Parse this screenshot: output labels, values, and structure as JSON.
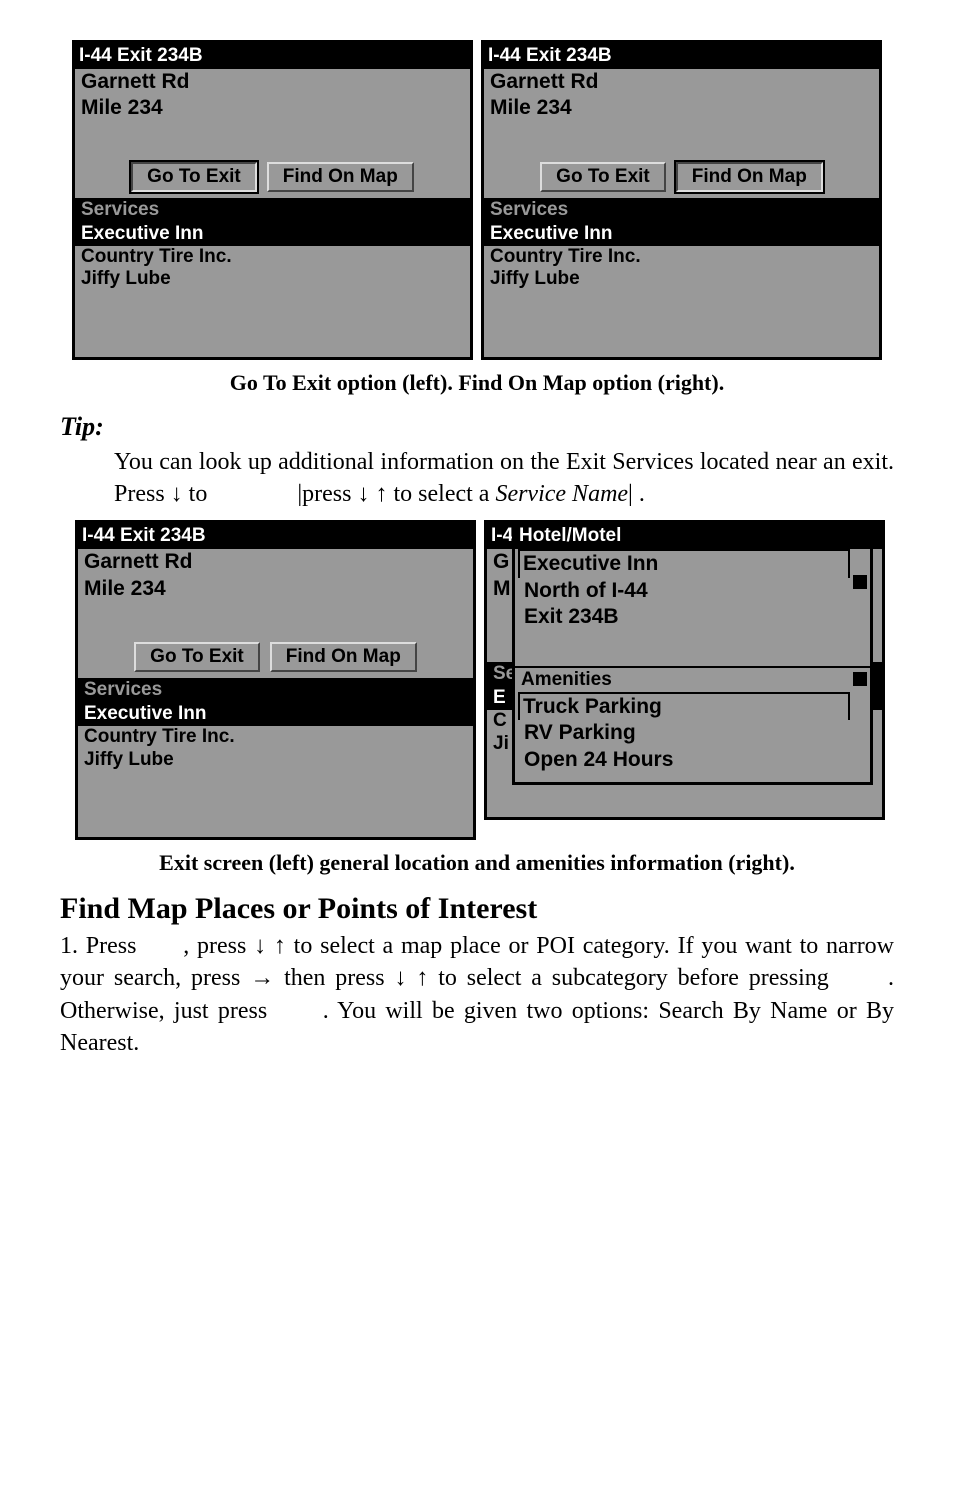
{
  "screens": {
    "left1": {
      "title": "I-44 Exit 234B",
      "line1": "Garnett Rd",
      "line2": "Mile 234",
      "btn1": "Go To Exit",
      "btn2": "Find On Map",
      "section": "Services",
      "item_sel": "Executive Inn",
      "item2": "Country Tire Inc.",
      "item3": "Jiffy Lube"
    },
    "right1": {
      "title": "I-44 Exit 234B",
      "line1": "Garnett Rd",
      "line2": "Mile 234",
      "btn1": "Go To Exit",
      "btn2": "Find On Map",
      "section": "Services",
      "item_sel": "Executive Inn",
      "item2": "Country Tire Inc.",
      "item3": "Jiffy Lube"
    },
    "left2": {
      "title": "I-44 Exit 234B",
      "line1": "Garnett Rd",
      "line2": "Mile 234",
      "btn1": "Go To Exit",
      "btn2": "Find On Map",
      "section": "Services",
      "item_sel": "Executive Inn",
      "item2": "Country Tire Inc.",
      "item3": "Jiffy Lube"
    },
    "popup": {
      "title": "Hotel/Motel",
      "l1": "Executive Inn",
      "l2": "North of I-44",
      "l3": "Exit 234B",
      "amen_label": "Amenities",
      "a1": "Truck Parking",
      "a2": "RV Parking",
      "a3": "Open 24 Hours"
    },
    "bg_hint": {
      "t": "I-4",
      "g": "G",
      "m": "M",
      "s": "Se",
      "e": "E",
      "c": "C",
      "j": "Ji"
    }
  },
  "captions": {
    "cap1": "Go To Exit option (left). Find On Map option (right).",
    "cap2": "Exit screen (left) general location and amenities information (right)."
  },
  "tip": {
    "label": "Tip:",
    "line1_a": "You can look up additional information on the Exit Services located near an exit. Press ",
    "line1_b": " to ",
    "line1_c": "|press ",
    "line1_d": " to select a ",
    "line1_svc": "Service Name",
    "line1_e": "| ."
  },
  "section": {
    "heading": "Find Map Places or Points of Interest",
    "p_a": "1. Press ",
    "p_b": ", press ",
    "p_c": " to select a map place or POI category. If you want to narrow your search, press ",
    "p_d": " then press ",
    "p_e": " to select a subcategory before pressing ",
    "p_f": ". Otherwise, just press ",
    "p_g": ". You will be given two options: Search By Name or By Nearest."
  },
  "glyphs": {
    "down": "↓",
    "up": "↑",
    "right": "→"
  }
}
